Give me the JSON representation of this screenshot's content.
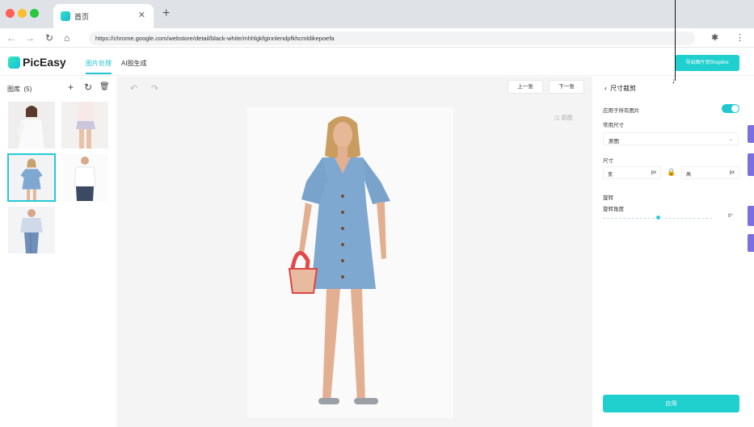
{
  "browser": {
    "tab_title": "首页",
    "url": "https://chrome.google.com/webstore/detail/black-white/mhhlgkfginnlendpfkhcmldikepoefa"
  },
  "app": {
    "logo": "PicEasy",
    "nav": [
      "图片处理",
      "AI图生成"
    ],
    "export_label": "导出图片到Shopline"
  },
  "library": {
    "title": "图库",
    "count": "(5)",
    "icons": [
      "plus-icon",
      "refresh-icon",
      "trash-icon"
    ]
  },
  "canvas": {
    "prev_label": "上一张",
    "next_label": "下一张",
    "compare_label": "原图"
  },
  "panel": {
    "back_title": "尺寸裁剪",
    "apply_all_label": "应用于所有图片",
    "apply_all_on": true,
    "common_size_label": "常用尺寸",
    "common_size_value": "原图",
    "size_label": "尺寸",
    "width_label": "宽",
    "height_label": "高",
    "unit": "px",
    "rotate_label": "旋转",
    "rotate_angle_label": "旋转角度",
    "rotate_value": "0°",
    "rotate_fraction": 0.5,
    "apply_label": "应用"
  },
  "colors": {
    "accent": "#1fd0cf",
    "dress": "#7fa8d0"
  }
}
